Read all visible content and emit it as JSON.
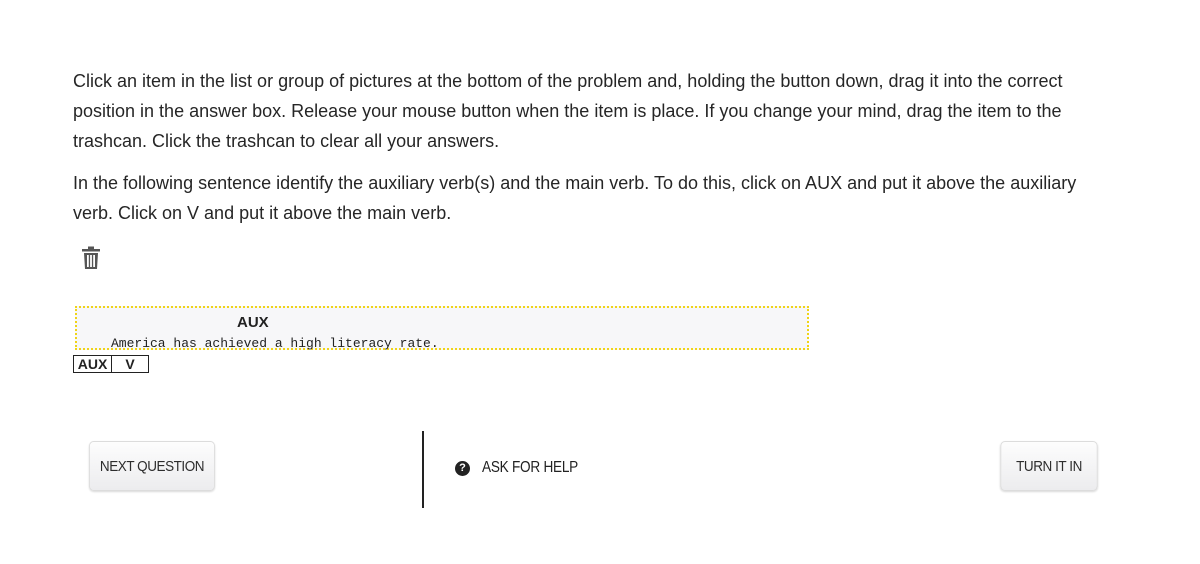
{
  "instructions": {
    "paragraph1": "Click an item in the list or group of pictures at the bottom of the problem and, holding the button down, drag it into the correct position in the answer box. Release your mouse button when the item is place. If you change your mind, drag the item to the trashcan. Click the trashcan to clear all your answers.",
    "paragraph2": "In the following sentence identify the auxiliary verb(s) and the main verb. To do this, click on AUX and put it above the auxiliary verb. Click on V and put it above the main verb."
  },
  "trash": {
    "icon": "trash-icon"
  },
  "answer_box": {
    "placed_label": "AUX",
    "sentence": "America has achieved a high literacy rate.",
    "border_color": "#f0d418"
  },
  "tokens": [
    {
      "label": "AUX"
    },
    {
      "label": "V"
    }
  ],
  "footer": {
    "next_question_label": "NEXT QUESTION",
    "help_icon_glyph": "?",
    "ask_for_help_label": "ASK FOR HELP",
    "turn_in_label": "TURN IT IN"
  }
}
